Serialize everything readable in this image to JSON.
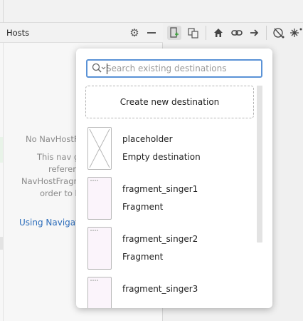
{
  "hosts_panel": {
    "title": "Hosts",
    "empty_line1": "No NavHostF",
    "empty_line2": "This nav g",
    "empty_line3": "referen",
    "empty_line4": "NavHostFragm",
    "empty_line5": "order to b",
    "link": "Using Navigati"
  },
  "popup": {
    "search": {
      "placeholder": "Search existing destinations",
      "value": ""
    },
    "create_label": "Create new destination",
    "destinations": [
      {
        "name": "placeholder",
        "type": "Empty destination"
      },
      {
        "name": "fragment_singer1",
        "type": "Fragment"
      },
      {
        "name": "fragment_singer2",
        "type": "Fragment"
      },
      {
        "name": "fragment_singer3",
        "type": ""
      }
    ]
  },
  "icons": {
    "toolbar": [
      "new-destination-icon",
      "nested-graph-icon",
      "home-icon",
      "link-icon",
      "arrow-right-icon",
      "auto-arrange-icon",
      "more-icon"
    ],
    "panel": [
      "gear-icon",
      "minimize-icon"
    ]
  },
  "colors": {
    "accent": "#5a92d6",
    "link": "#2c6dbb"
  }
}
